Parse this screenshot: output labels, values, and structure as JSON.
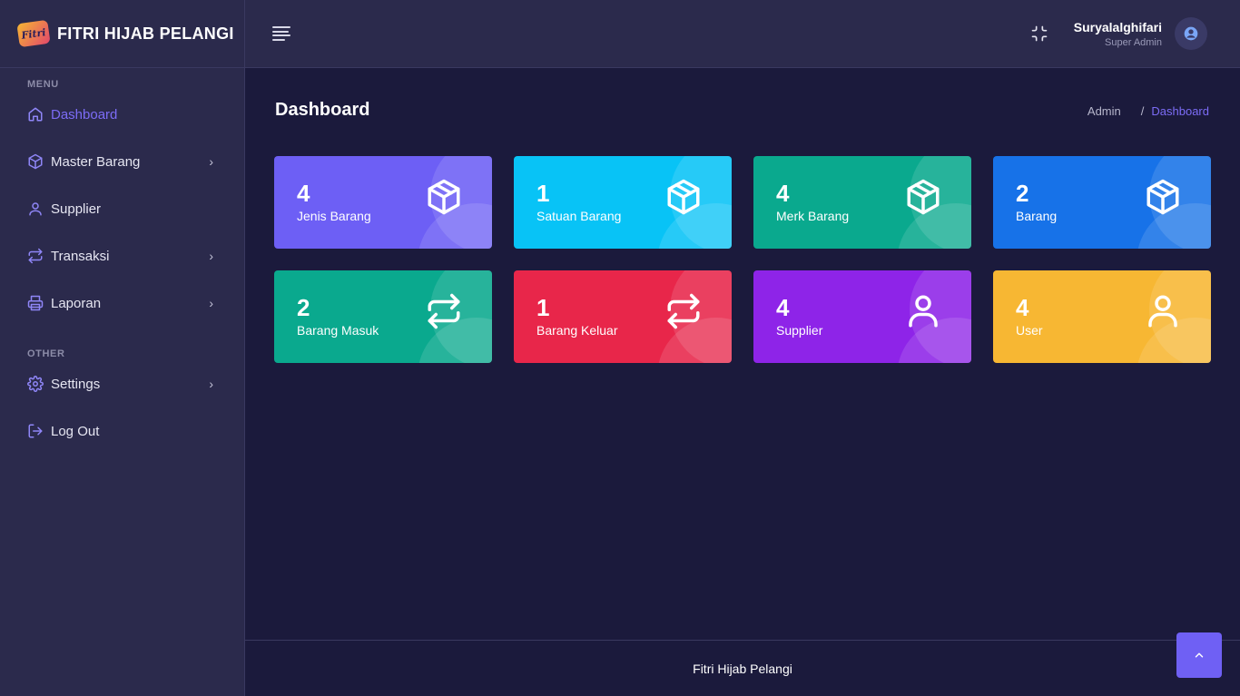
{
  "brand": {
    "logo_text": "Fitri",
    "name": "FITRI HIJAB PELANGI"
  },
  "sidebar": {
    "sections": [
      {
        "title": "MENU",
        "items": [
          {
            "label": "Dashboard",
            "icon": "home-icon",
            "active": true,
            "has_submenu": false
          },
          {
            "label": "Master Barang",
            "icon": "box-icon",
            "active": false,
            "has_submenu": true
          },
          {
            "label": "Supplier",
            "icon": "user-icon",
            "active": false,
            "has_submenu": false
          },
          {
            "label": "Transaksi",
            "icon": "repeat-icon",
            "active": false,
            "has_submenu": true
          },
          {
            "label": "Laporan",
            "icon": "printer-icon",
            "active": false,
            "has_submenu": true
          }
        ]
      },
      {
        "title": "OTHER",
        "items": [
          {
            "label": "Settings",
            "icon": "gear-icon",
            "active": false,
            "has_submenu": true
          },
          {
            "label": "Log Out",
            "icon": "logout-icon",
            "active": false,
            "has_submenu": false
          }
        ]
      }
    ]
  },
  "header": {
    "user_name": "Suryalalghifari",
    "user_role": "Super Admin"
  },
  "main": {
    "title": "Dashboard",
    "breadcrumb": {
      "root": "Admin",
      "separator": "/",
      "current": "Dashboard"
    },
    "cards": [
      {
        "value": "4",
        "label": "Jenis Barang",
        "icon": "box-icon",
        "color": "#6d5ff5"
      },
      {
        "value": "1",
        "label": "Satuan Barang",
        "icon": "box-icon",
        "color": "#08c3f6"
      },
      {
        "value": "4",
        "label": "Merk Barang",
        "icon": "box-icon",
        "color": "#0aa98e"
      },
      {
        "value": "2",
        "label": "Barang",
        "icon": "box-icon",
        "color": "#1772e8"
      },
      {
        "value": "2",
        "label": "Barang Masuk",
        "icon": "repeat-icon",
        "color": "#0aa98e"
      },
      {
        "value": "1",
        "label": "Barang Keluar",
        "icon": "repeat-icon",
        "color": "#e8264a"
      },
      {
        "value": "4",
        "label": "Supplier",
        "icon": "user-icon",
        "color": "#8e24e8"
      },
      {
        "value": "4",
        "label": "User",
        "icon": "user-icon",
        "color": "#f7b733"
      }
    ]
  },
  "footer": {
    "text": "Fitri Hijab Pelangi"
  },
  "colors": {
    "accent": "#7c6cf6",
    "background": "#1b1a3c",
    "sidebar": "#2b2a4c"
  }
}
